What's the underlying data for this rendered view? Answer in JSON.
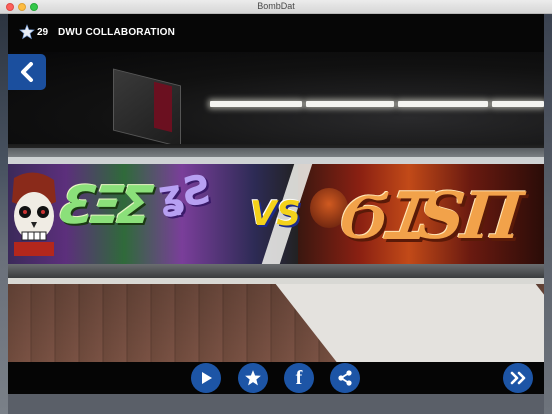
{
  "window": {
    "title": "BombDat"
  },
  "header": {
    "score": "29",
    "title": "DWU COLLABORATION"
  },
  "mural": {
    "vs_text": "VS"
  },
  "icons": {
    "back": "chevron-left-icon",
    "play": "play-icon",
    "favorite": "star-icon",
    "facebook": "facebook-icon",
    "share": "share-icon",
    "next": "double-chevron-right-icon"
  },
  "colors": {
    "accent": "#1d55a6",
    "header_bg": "#060606"
  }
}
